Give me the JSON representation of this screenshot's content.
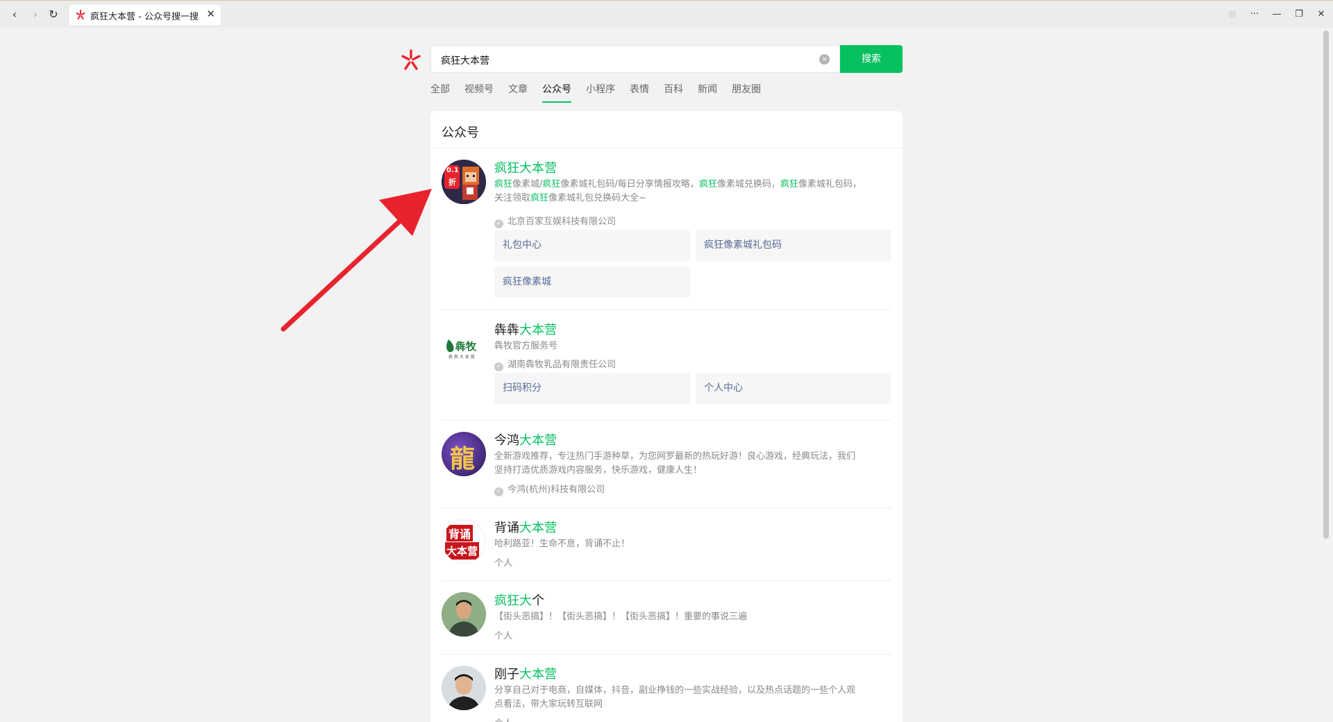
{
  "browser": {
    "tab_title": "疯狂大本营 - 公众号搜一搜",
    "tab_close": "✕",
    "back": "‹",
    "forward": "›",
    "reload": "↻",
    "more": "···",
    "minimize": "—",
    "restore": "❐",
    "close": "✕",
    "globe": "◎"
  },
  "search": {
    "query": "疯狂大本营",
    "clear": "×",
    "button_label": "搜索"
  },
  "filters": [
    {
      "label": "全部"
    },
    {
      "label": "视频号"
    },
    {
      "label": "文章"
    },
    {
      "label": "公众号",
      "active": true
    },
    {
      "label": "小程序"
    },
    {
      "label": "表情"
    },
    {
      "label": "百科"
    },
    {
      "label": "新闻"
    },
    {
      "label": "朋友圈"
    }
  ],
  "results_section_title": "公众号",
  "results": [
    {
      "name_plain": "",
      "name_hl": "疯狂大本营",
      "name_suffix": "",
      "desc_1": "疯狂像素城/疯狂像素城礼包码/每日分享情报攻略，疯狂像素城兑换码，疯狂像素城礼包码，",
      "desc_2": "关注领取疯狂像素城礼包兑换码大全~",
      "owner": "北京百家互娱科技有限公司",
      "verified": true,
      "avatar_badge_1": "0.1",
      "avatar_badge_2": "折",
      "links": [
        "礼包中心",
        "疯狂像素城礼包码",
        "疯狂像素城"
      ]
    },
    {
      "name_plain": "犇犇",
      "name_hl": "大本营",
      "name_suffix": "",
      "desc_1": "犇牧官方服务号",
      "desc_2": "",
      "owner": "湖南犇牧乳品有限责任公司",
      "verified": true,
      "avatar_text": "犇牧",
      "avatar_sub": "犇 犇 大 本 营",
      "links": [
        "扫码积分",
        "个人中心"
      ]
    },
    {
      "name_plain": "今鸿",
      "name_hl": "大本营",
      "name_suffix": "",
      "desc_1": "全新游戏推荐，专注热门手游种草，为您网罗最新的热玩好游！良心游戏，经典玩法，我们",
      "desc_2": "坚持打造优质游戏内容服务，快乐游戏，健康人生！",
      "owner": "今鸿(杭州)科技有限公司",
      "verified": true,
      "avatar_text": "龍"
    },
    {
      "name_plain": "背诵",
      "name_hl": "大本营",
      "name_suffix": "",
      "desc_1": "哈利路亚！生命不息，背诵不止！",
      "desc_2": "",
      "owner": "个人",
      "verified": false,
      "avatar_text_1": "背诵",
      "avatar_text_2": "大本营"
    },
    {
      "name_plain": "",
      "name_hl": "疯狂大",
      "name_suffix": "个",
      "desc_1": "【街头恶搞】！【街头恶搞】！【街头恶搞】！重要的事说三遍",
      "desc_2": "",
      "owner": "个人",
      "verified": false
    },
    {
      "name_plain": "刚子",
      "name_hl": "大本营",
      "name_suffix": "",
      "desc_1": "分享自己对于电商，自媒体，抖音，副业挣钱的一些实战经验，以及热点话题的一些个人观",
      "desc_2": "点看法，带大家玩转互联网",
      "owner": "个人",
      "verified": false
    }
  ],
  "colors": {
    "accent": "#07c160",
    "link": "#576b95",
    "arrow": "#e8232e"
  }
}
